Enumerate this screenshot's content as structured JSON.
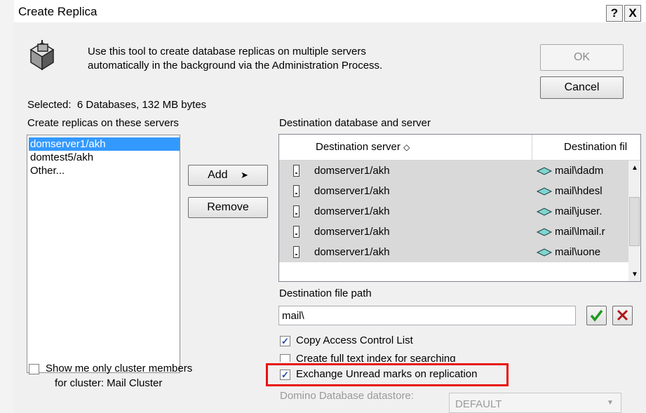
{
  "window": {
    "title": "Create Replica",
    "help_button": "?",
    "close_button": "X"
  },
  "intro": {
    "line1": "Use this tool to create database replicas on multiple servers",
    "line2": "automatically in the background via the Administration Process."
  },
  "buttons": {
    "ok": "OK",
    "cancel": "Cancel",
    "add": "Add",
    "remove": "Remove"
  },
  "selected": {
    "label": "Selected:",
    "value": "6 Databases, 132 MB bytes"
  },
  "servers_section": {
    "label": "Create replicas on these servers",
    "items": [
      "domserver1/akh",
      "domtest5/akh",
      "Other..."
    ],
    "selected_index": 0
  },
  "destination_section": {
    "label": "Destination database and server",
    "col_server": "Destination server",
    "col_file": "Destination fil",
    "rows": [
      {
        "server": "domserver1/akh",
        "file": "mail\\dadm"
      },
      {
        "server": "domserver1/akh",
        "file": "mail\\hdesl"
      },
      {
        "server": "domserver1/akh",
        "file": "mail\\juser."
      },
      {
        "server": "domserver1/akh",
        "file": "mail\\lmail.r"
      },
      {
        "server": "domserver1/akh",
        "file": "mail\\uone"
      }
    ]
  },
  "file_path": {
    "label": "Destination file path",
    "value": "mail\\"
  },
  "options": {
    "copy_acl": {
      "label": "Copy Access Control List",
      "checked": true
    },
    "full_text": {
      "label": "Create full text index for searching",
      "checked": false
    },
    "unread_marks": {
      "label": "Exchange Unread marks on replication",
      "checked": true
    }
  },
  "cluster_option": {
    "line1": "Show me only cluster members",
    "line2": "for cluster: Mail Cluster",
    "checked": false
  },
  "datastore": {
    "label": "Domino Database datastore:",
    "value": "DEFAULT"
  },
  "colors": {
    "highlight_box": "#e8120c",
    "selection": "#3399ff",
    "dialog_bg": "#f0f0f0"
  }
}
